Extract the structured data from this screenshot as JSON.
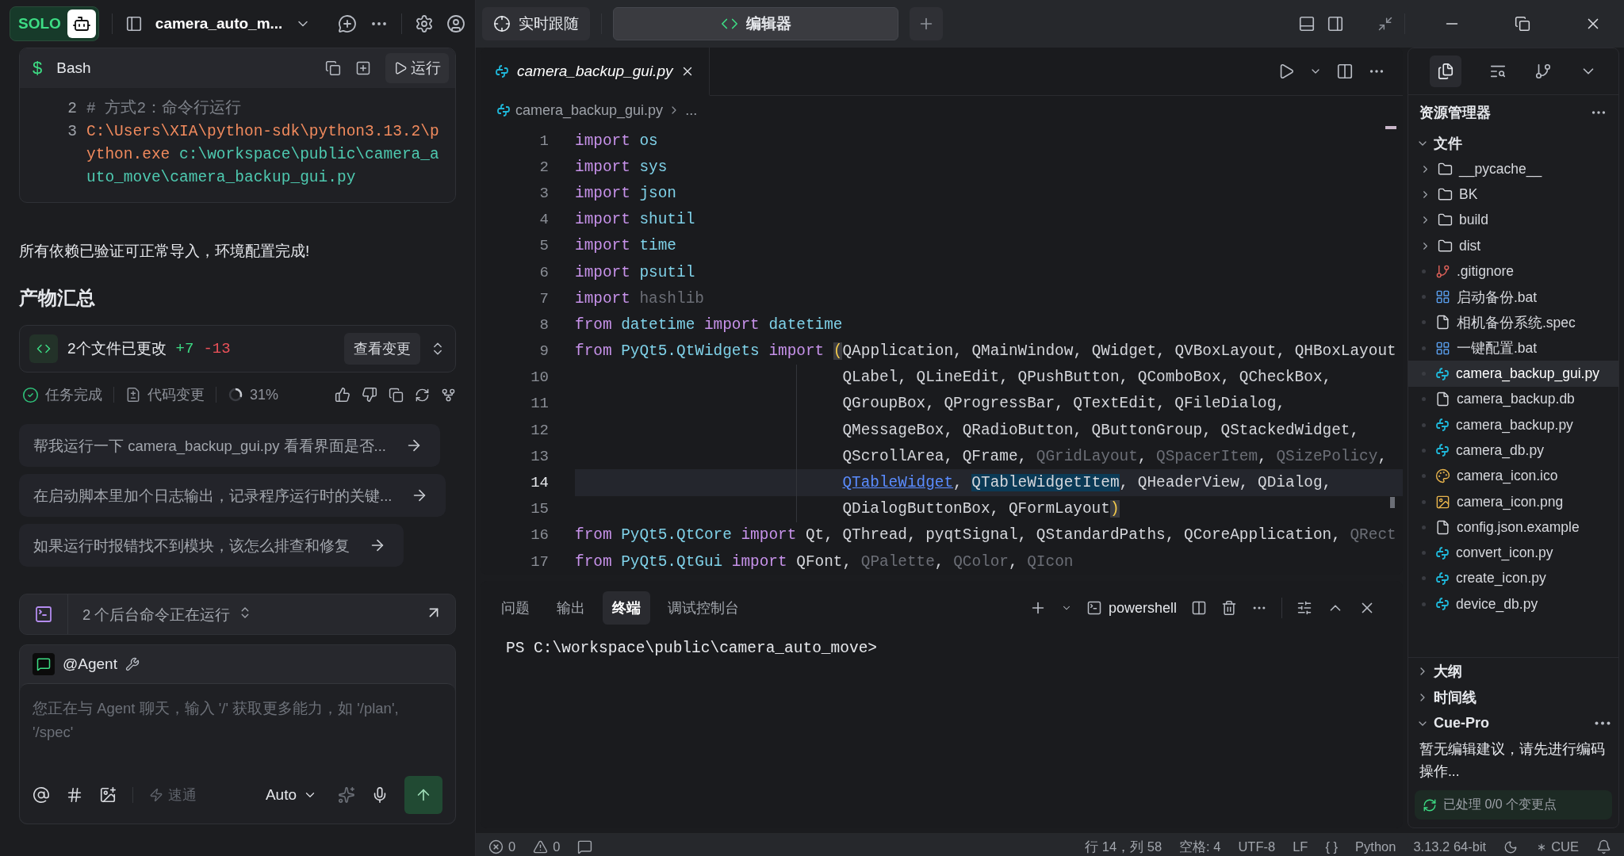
{
  "sidebar": {
    "badge": "SOLO",
    "project": "camera_auto_m...",
    "bash_card": {
      "prompt_symbol": "$",
      "title": "Bash",
      "run_button": "运行",
      "lines": [
        {
          "number": "2",
          "segments": [
            {
              "kind": "comment",
              "text": "# 方式2：命令行运行"
            }
          ]
        },
        {
          "number": "3",
          "segments": [
            {
              "kind": "exe",
              "text": "C:\\Users\\XIA\\python-sdk\\python3.13.2\\python.exe "
            },
            {
              "kind": "path",
              "text": "c:\\workspace\\public\\camera_auto_move\\camera_backup_gui.py"
            }
          ]
        }
      ]
    },
    "status_message": "所有依赖已验证可正常导入，环境配置完成!",
    "summary_title": "产物汇总",
    "changes": {
      "label": "2个文件已更改",
      "added": "+7",
      "removed": "-13",
      "button": "查看变更"
    },
    "task_status": [
      {
        "kind": "done",
        "label": "任务完成"
      },
      {
        "kind": "changes",
        "label": "代码变更"
      },
      {
        "kind": "progress",
        "label": "31%",
        "level": 0.31
      }
    ],
    "suggestions": [
      "帮我运行一下 camera_backup_gui.py 看看界面是否...",
      "在启动脚本里加个日志输出，记录程序运行时的关键...",
      "如果运行时报错找不到模块，该怎么排查和修复"
    ],
    "background_commands": "2 个后台命令正在运行",
    "agent": {
      "name": "@Agent",
      "placeholder": "您正在与 Agent 聊天，输入 '/' 获取更多能力，如 '/plan', '/spec'",
      "fast_mode": {
        "label": "速通",
        "on": false
      },
      "model": "Auto"
    }
  },
  "top_tabs": [
    {
      "label": "实时跟随",
      "kind": "follow",
      "selected": false
    },
    {
      "label": "编辑器",
      "kind": "editor",
      "selected": true
    }
  ],
  "editor": {
    "tab": "camera_backup_gui.py",
    "breadcrumb": [
      "camera_backup_gui.py",
      "..."
    ],
    "lines": [
      {
        "number": "1",
        "current": false,
        "continuation": false,
        "segments": [
          {
            "kind": "kw",
            "text": "import"
          },
          {
            "kind": "mod",
            "text": " os"
          }
        ]
      },
      {
        "number": "2",
        "current": false,
        "continuation": false,
        "segments": [
          {
            "kind": "kw",
            "text": "import"
          },
          {
            "kind": "mod",
            "text": " sys"
          }
        ]
      },
      {
        "number": "3",
        "current": false,
        "continuation": false,
        "segments": [
          {
            "kind": "kw",
            "text": "import"
          },
          {
            "kind": "mod",
            "text": " json"
          }
        ]
      },
      {
        "number": "4",
        "current": false,
        "continuation": false,
        "segments": [
          {
            "kind": "kw",
            "text": "import"
          },
          {
            "kind": "mod",
            "text": " shutil"
          }
        ]
      },
      {
        "number": "5",
        "current": false,
        "continuation": false,
        "segments": [
          {
            "kind": "kw",
            "text": "import"
          },
          {
            "kind": "mod",
            "text": " time"
          }
        ]
      },
      {
        "number": "6",
        "current": false,
        "continuation": false,
        "segments": [
          {
            "kind": "kw",
            "text": "import"
          },
          {
            "kind": "mod",
            "text": " psutil"
          }
        ]
      },
      {
        "number": "7",
        "current": false,
        "continuation": false,
        "segments": [
          {
            "kind": "kw",
            "text": "import"
          },
          {
            "kind": "dim",
            "text": " hashlib"
          }
        ]
      },
      {
        "number": "8",
        "current": false,
        "continuation": false,
        "segments": [
          {
            "kind": "kw",
            "text": "from"
          },
          {
            "kind": "mod",
            "text": " datetime "
          },
          {
            "kind": "kw",
            "text": "import"
          },
          {
            "kind": "mod",
            "text": " datetime"
          }
        ]
      },
      {
        "number": "9",
        "current": false,
        "continuation": false,
        "segments": [
          {
            "kind": "kw",
            "text": "from"
          },
          {
            "kind": "mod",
            "text": " PyQt5.QtWidgets "
          },
          {
            "kind": "kw",
            "text": "import "
          },
          {
            "kind": "bracket",
            "text": "("
          },
          {
            "kind": "plain",
            "text": "QApplication, QMainWindow, QWidget, QVBoxLayout, QHBoxLayout"
          }
        ]
      },
      {
        "number": "10",
        "current": false,
        "continuation": true,
        "segments": [
          {
            "kind": "plain",
            "text": "QLabel, QLineEdit, QPushButton, QComboBox, QCheckBox,"
          }
        ]
      },
      {
        "number": "11",
        "current": false,
        "continuation": true,
        "segments": [
          {
            "kind": "plain",
            "text": "QGroupBox, QProgressBar, QTextEdit, QFileDialog,"
          }
        ]
      },
      {
        "number": "12",
        "current": false,
        "continuation": true,
        "segments": [
          {
            "kind": "plain",
            "text": "QMessageBox, QRadioButton, QButtonGroup, QStackedWidget,"
          }
        ]
      },
      {
        "number": "13",
        "current": false,
        "continuation": true,
        "segments": [
          {
            "kind": "plain",
            "text": "QScrollArea, QFrame, "
          },
          {
            "kind": "dim",
            "text": "QGridLayout"
          },
          {
            "kind": "plain",
            "text": ", "
          },
          {
            "kind": "dim",
            "text": "QSpacerItem"
          },
          {
            "kind": "plain",
            "text": ", "
          },
          {
            "kind": "dim",
            "text": "QSizePolicy"
          },
          {
            "kind": "plain",
            "text": ","
          }
        ]
      },
      {
        "number": "14",
        "current": true,
        "continuation": true,
        "segments": [
          {
            "kind": "link",
            "text": "QTableWidget"
          },
          {
            "kind": "plain",
            "text": ", "
          },
          {
            "kind": "sel",
            "text": "QTableWidgetItem"
          },
          {
            "kind": "plain",
            "text": ", QHeaderView, QDialog,"
          }
        ]
      },
      {
        "number": "15",
        "current": false,
        "continuation": true,
        "segments": [
          {
            "kind": "plain",
            "text": "QDialogButtonBox, QFormLayout"
          },
          {
            "kind": "bracket",
            "text": ")"
          }
        ]
      },
      {
        "number": "16",
        "current": false,
        "continuation": false,
        "segments": [
          {
            "kind": "kw",
            "text": "from"
          },
          {
            "kind": "mod",
            "text": " PyQt5.QtCore "
          },
          {
            "kind": "kw",
            "text": "import"
          },
          {
            "kind": "plain",
            "text": " Qt, QThread, pyqtSignal, QStandardPaths, QCoreApplication, "
          },
          {
            "kind": "dim",
            "text": "QRect"
          }
        ]
      },
      {
        "number": "17",
        "current": false,
        "continuation": false,
        "segments": [
          {
            "kind": "kw",
            "text": "from"
          },
          {
            "kind": "mod",
            "text": " PyQt5.QtGui "
          },
          {
            "kind": "kw",
            "text": "import"
          },
          {
            "kind": "plain",
            "text": " QFont, "
          },
          {
            "kind": "dim",
            "text": "QPalette"
          },
          {
            "kind": "plain",
            "text": ", "
          },
          {
            "kind": "dim",
            "text": "QColor"
          },
          {
            "kind": "plain",
            "text": ", "
          },
          {
            "kind": "dim",
            "text": "QIcon"
          }
        ]
      }
    ]
  },
  "panel": {
    "tabs": [
      {
        "label": "问题",
        "selected": false
      },
      {
        "label": "输出",
        "selected": false
      },
      {
        "label": "终端",
        "selected": true
      },
      {
        "label": "调试控制台",
        "selected": false
      }
    ],
    "shell": "powershell",
    "output": "PS C:\\workspace\\public\\camera_auto_move>"
  },
  "explorer": {
    "title": "资源管理器",
    "files": {
      "title": "文件",
      "expanded": true,
      "items": [
        {
          "name": "__pycache__",
          "kind": "folder",
          "selected": false
        },
        {
          "name": "BK",
          "kind": "folder",
          "selected": false
        },
        {
          "name": "build",
          "kind": "folder",
          "selected": false
        },
        {
          "name": "dist",
          "kind": "folder",
          "selected": false
        },
        {
          "name": ".gitignore",
          "kind": "git",
          "selected": false
        },
        {
          "name": "启动备份.bat",
          "kind": "script",
          "selected": false
        },
        {
          "name": "相机备份系统.spec",
          "kind": "document",
          "selected": false
        },
        {
          "name": "一键配置.bat",
          "kind": "script",
          "selected": false
        },
        {
          "name": "camera_backup_gui.py",
          "kind": "python",
          "selected": true
        },
        {
          "name": "camera_backup.db",
          "kind": "document",
          "selected": false
        },
        {
          "name": "camera_backup.py",
          "kind": "python",
          "selected": false
        },
        {
          "name": "camera_db.py",
          "kind": "python",
          "selected": false
        },
        {
          "name": "camera_icon.ico",
          "kind": "icon",
          "selected": false
        },
        {
          "name": "camera_icon.png",
          "kind": "image",
          "selected": false
        },
        {
          "name": "config.json.example",
          "kind": "document",
          "selected": false
        },
        {
          "name": "convert_icon.py",
          "kind": "python",
          "selected": false
        },
        {
          "name": "create_icon.py",
          "kind": "python",
          "selected": false
        },
        {
          "name": "device_db.py",
          "kind": "python",
          "selected": false
        }
      ]
    },
    "outline": {
      "title": "大纲",
      "expanded": false
    },
    "timeline": {
      "title": "时间线",
      "expanded": false
    },
    "cue_pro": {
      "title": "Cue-Pro",
      "expanded": true,
      "message": "暂无编辑建议，请先进行编码操作...",
      "status": "已处理 0/0 个变更点"
    }
  },
  "status_bar": {
    "errors": "0",
    "warnings": "0",
    "items": [
      "行 14，列 58",
      "空格: 4",
      "UTF-8",
      "LF",
      "{ }",
      "Python",
      "3.13.2 64-bit"
    ],
    "cue": "CUE"
  }
}
